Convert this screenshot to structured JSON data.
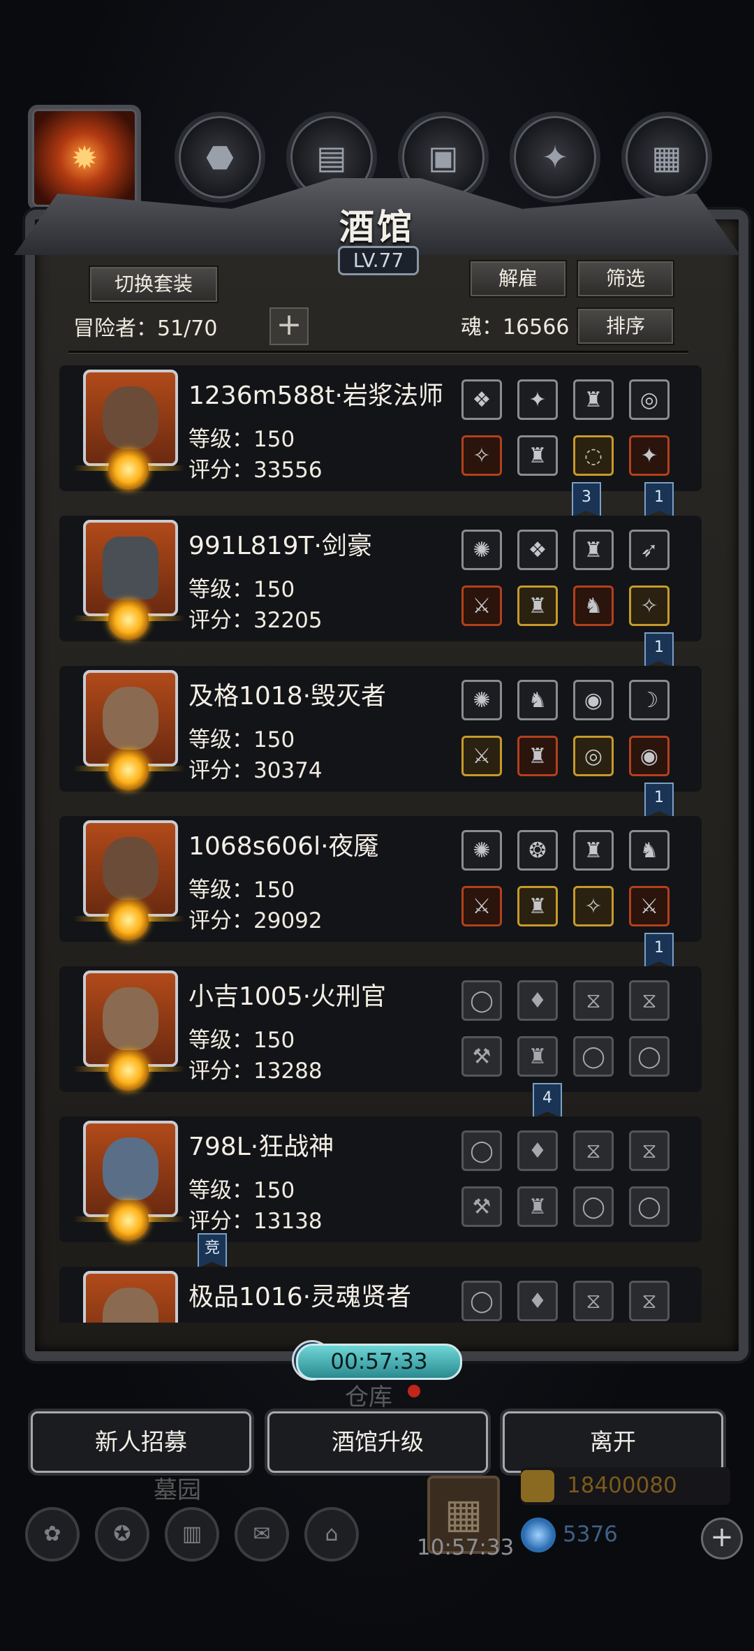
{
  "title": "酒馆",
  "level": "LV.77",
  "buttons": {
    "switch_outfit": "切换套装",
    "dismiss": "解雇",
    "filter": "筛选",
    "sort": "排序"
  },
  "adventurers": "冒险者：51/70",
  "soul": "魂：16566",
  "heroes": [
    {
      "name": "1236m588t·岩浆法师",
      "level": "等级：150",
      "score": "评分：33556",
      "slots_top": [
        "❖",
        "✦",
        "♜",
        "◎"
      ],
      "slots_bottom": [
        "✧",
        "♜",
        "◌",
        "✦"
      ],
      "empty": false
    },
    {
      "name": "991L819T·剑豪",
      "level": "等级：150",
      "score": "评分：32205",
      "slots_top": [
        "✺",
        "❖",
        "♜",
        "➶"
      ],
      "slots_bottom": [
        "⚔",
        "♜",
        "♞",
        "✧"
      ],
      "empty": false
    },
    {
      "name": "及格1018·毁灭者",
      "level": "等级：150",
      "score": "评分：30374",
      "slots_top": [
        "✺",
        "♞",
        "◉",
        "☽"
      ],
      "slots_bottom": [
        "⚔",
        "♜",
        "◎",
        "◉"
      ],
      "empty": false
    },
    {
      "name": "1068s606l·夜魇",
      "level": "等级：150",
      "score": "评分：29092",
      "slots_top": [
        "✺",
        "❂",
        "♜",
        "♞"
      ],
      "slots_bottom": [
        "⚔",
        "♜",
        "✧",
        "⚔"
      ],
      "empty": false
    },
    {
      "name": "小吉1005·火刑官",
      "level": "等级：150",
      "score": "评分：13288",
      "slots_top": [
        "◯",
        "♦",
        "⧖",
        "⧖"
      ],
      "slots_bottom": [
        "⚒",
        "♜",
        "◯",
        "◯"
      ],
      "empty": true
    },
    {
      "name": "798L·狂战神",
      "level": "等级：150",
      "score": "评分：13138",
      "slots_top": [
        "◯",
        "♦",
        "⧖",
        "⧖"
      ],
      "slots_bottom": [
        "⚒",
        "♜",
        "◯",
        "◯"
      ],
      "empty": true
    },
    {
      "name": "极品1016·灵魂贤者",
      "level": "",
      "score": "",
      "slots_top": [
        "◯",
        "♦",
        "⧖",
        "⧖"
      ],
      "slots_bottom": [],
      "empty": true
    }
  ],
  "tags": [
    "3",
    "1",
    "1",
    "1",
    "1",
    "4",
    "竞"
  ],
  "timer": "00:57:33",
  "warehouse": "仓库",
  "cemetery": "墓园",
  "actions": {
    "recruit": "新人招募",
    "upgrade": "酒馆升级",
    "leave": "离开"
  },
  "gift_timer": "10:57:33",
  "gold": "18400080",
  "gems": "5376",
  "colors": {
    "gold": "#c79a2a",
    "red": "#b3401c",
    "tag_blue": "#1a3455",
    "timer": "#6fd6d6"
  }
}
